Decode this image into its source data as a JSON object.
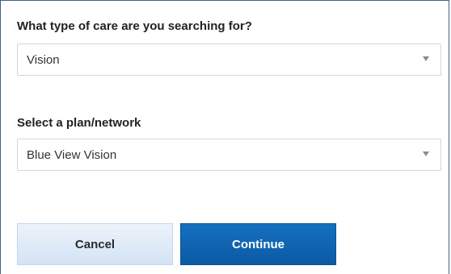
{
  "form": {
    "care_type_label": "What type of care are you searching for?",
    "care_type_value": "Vision",
    "plan_label": "Select a plan/network",
    "plan_value": "Blue View Vision"
  },
  "buttons": {
    "cancel": "Cancel",
    "continue": "Continue"
  },
  "icons": {
    "dropdown": "chevron-down-icon"
  },
  "colors": {
    "primary_button": "#0b5aa3",
    "secondary_button": "#dce8f6",
    "panel_border": "#3f5f8f"
  }
}
